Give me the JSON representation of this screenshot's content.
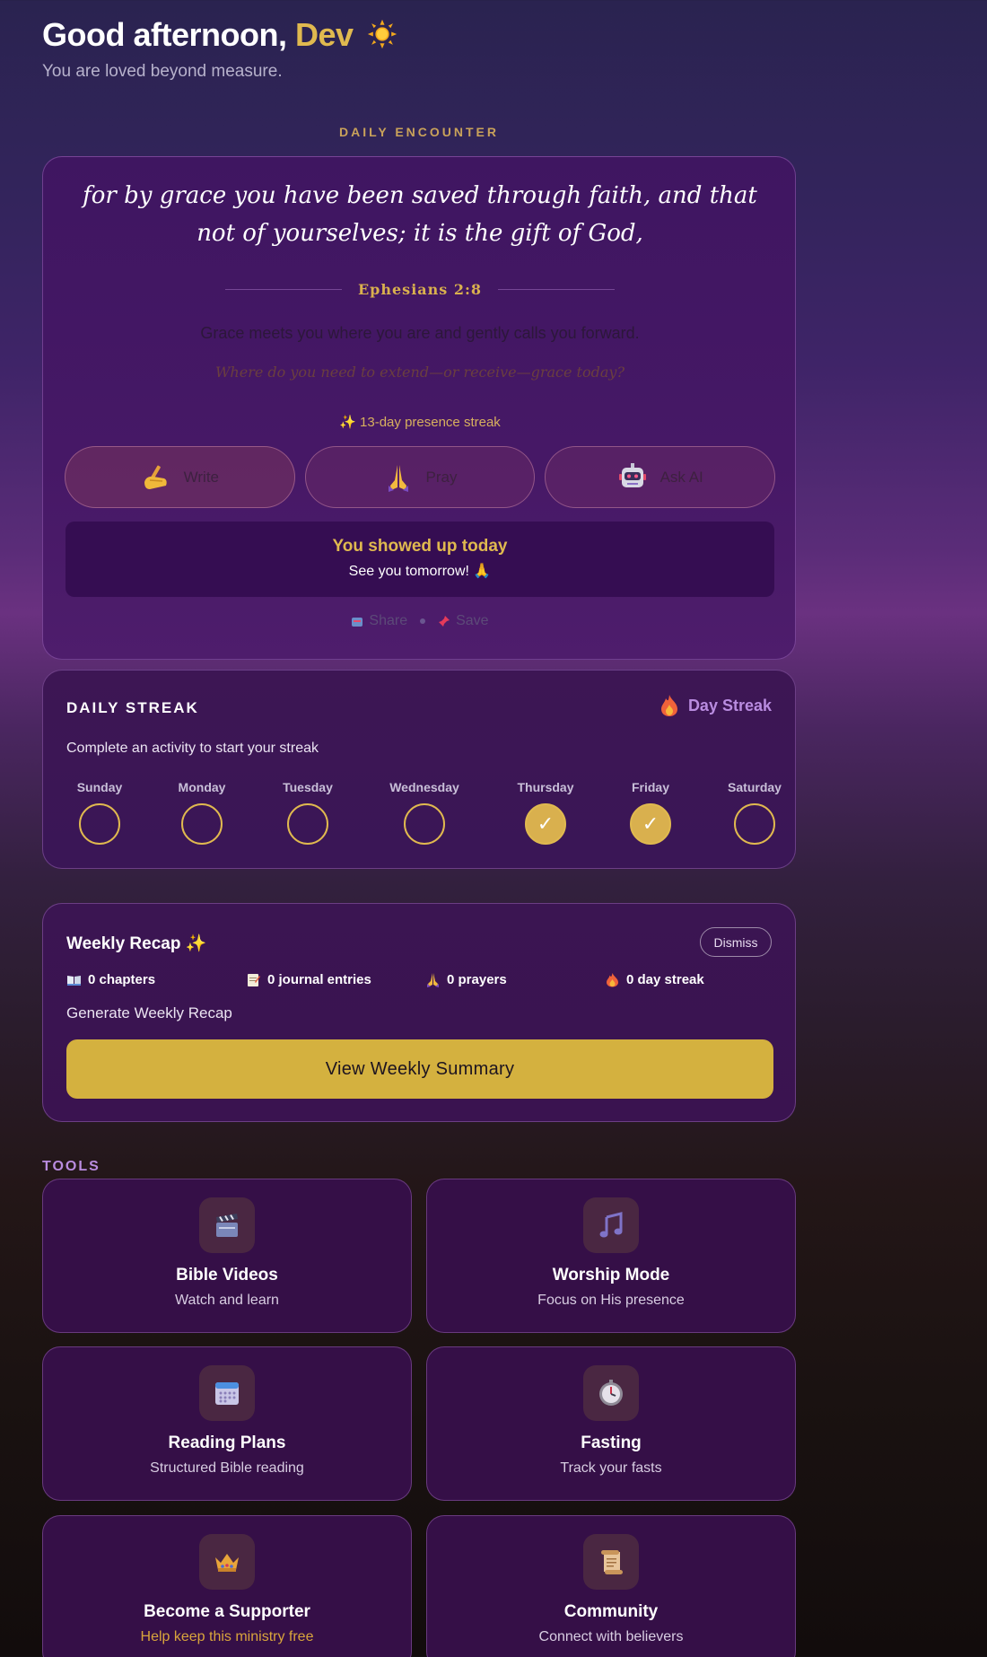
{
  "header": {
    "greeting": "Good afternoon,",
    "name": "Dev",
    "subtitle": "You are loved beyond measure."
  },
  "daily_encounter": {
    "section_label": "DAILY ENCOUNTER",
    "verse": "for by grace you have been saved through faith, and that not of yourselves; it is the gift of God,",
    "reference": "Ephesians 2:8",
    "reflection": "Grace meets you where you are and gently calls you forward.",
    "question": "Where do you need to extend—or receive—grace today?",
    "streak_note": "✨ 13-day presence streak",
    "actions": [
      {
        "label": "Write",
        "icon": "writing-hand-icon"
      },
      {
        "label": "Pray",
        "icon": "praying-hands-icon"
      },
      {
        "label": "Ask AI",
        "icon": "robot-icon"
      }
    ],
    "status_title": "You showed up today",
    "status_sub": "See you tomorrow! 🙏",
    "share_label": "Share",
    "save_label": "Save"
  },
  "daily_streak": {
    "title": "DAILY STREAK",
    "badge": "Day Streak",
    "subtitle": "Complete an activity to start your streak",
    "days": [
      {
        "name": "Sunday",
        "done": false
      },
      {
        "name": "Monday",
        "done": false
      },
      {
        "name": "Tuesday",
        "done": false
      },
      {
        "name": "Wednesday",
        "done": false
      },
      {
        "name": "Thursday",
        "done": true
      },
      {
        "name": "Friday",
        "done": true
      },
      {
        "name": "Saturday",
        "done": false
      }
    ],
    "check": "✓"
  },
  "weekly_recap": {
    "title": "Weekly Recap ✨",
    "dismiss": "Dismiss",
    "stats": [
      {
        "icon": "open-book-icon",
        "text": "0 chapters"
      },
      {
        "icon": "memo-icon",
        "text": "0 journal entries"
      },
      {
        "icon": "praying-hands-icon",
        "text": "0 prayers"
      },
      {
        "icon": "fire-icon",
        "text": "0 day streak"
      }
    ],
    "generate_label": "Generate Weekly Recap",
    "view_button": "View Weekly Summary"
  },
  "tools": {
    "label": "TOOLS",
    "items": [
      {
        "name": "Bible Videos",
        "sub": "Watch and learn",
        "icon": "clapperboard-icon"
      },
      {
        "name": "Worship Mode",
        "sub": "Focus on His presence",
        "icon": "music-note-icon"
      },
      {
        "name": "Reading Plans",
        "sub": "Structured Bible reading",
        "icon": "calendar-icon"
      },
      {
        "name": "Fasting",
        "sub": "Track your fasts",
        "icon": "stopwatch-icon"
      },
      {
        "name": "Become a Supporter",
        "sub": "Help keep this ministry free",
        "icon": "crown-icon"
      },
      {
        "name": "Community",
        "sub": "Connect with believers",
        "icon": "scroll-icon"
      }
    ]
  },
  "colors": {
    "accent_gold": "#d4b13f",
    "lavender": "#b98ce0",
    "card_purple": "#3f1661"
  }
}
